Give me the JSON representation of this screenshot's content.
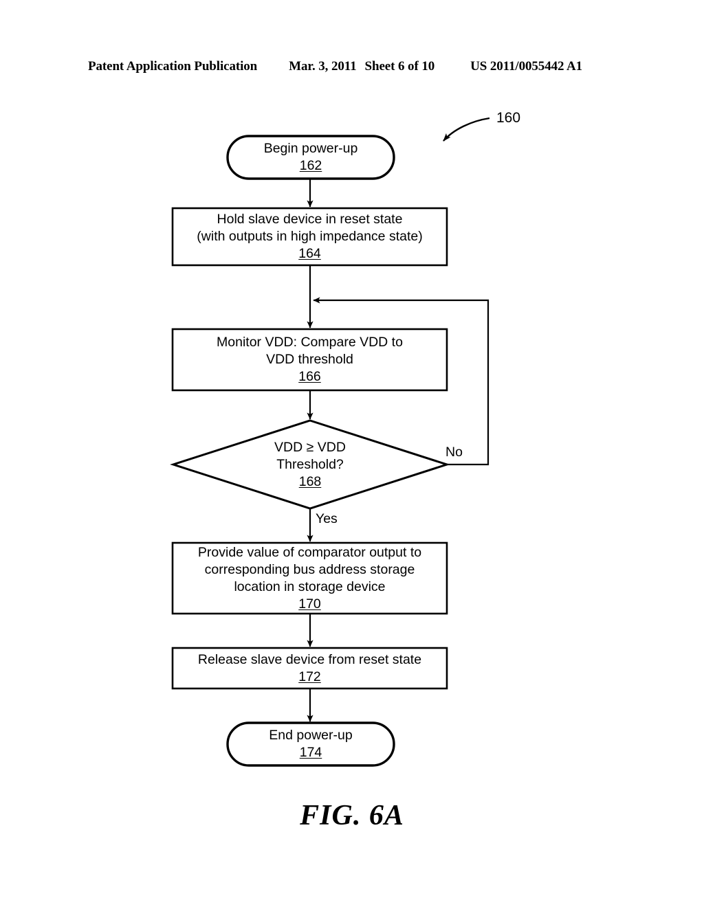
{
  "header": {
    "publication": "Patent Application Publication",
    "date": "Mar. 3, 2011",
    "sheet": "Sheet 6 of 10",
    "patent_number": "US 2011/0055442 A1"
  },
  "figure": {
    "caption": "FIG. 6A",
    "callout_ref": "160"
  },
  "flowchart": {
    "nodes": [
      {
        "id": "begin",
        "shape": "stadium",
        "lines": [
          "Begin power-up"
        ],
        "ref": "162"
      },
      {
        "id": "hold-reset",
        "shape": "rect",
        "lines": [
          "Hold slave device in reset state",
          "(with outputs in high impedance state)"
        ],
        "ref": "164"
      },
      {
        "id": "monitor-vdd",
        "shape": "rect",
        "lines": [
          "Monitor VDD: Compare VDD to",
          "VDD threshold"
        ],
        "ref": "166"
      },
      {
        "id": "vdd-decision",
        "shape": "diamond",
        "lines": [
          "VDD  ≥ VDD",
          "Threshold?"
        ],
        "ref": "168"
      },
      {
        "id": "provide-value",
        "shape": "rect",
        "lines": [
          "Provide value of comparator output to",
          "corresponding bus address storage",
          "location in storage device"
        ],
        "ref": "170"
      },
      {
        "id": "release-reset",
        "shape": "rect",
        "lines": [
          "Release slave device from reset state"
        ],
        "ref": "172"
      },
      {
        "id": "end",
        "shape": "stadium",
        "lines": [
          "End power-up"
        ],
        "ref": "174"
      }
    ],
    "edge_labels": {
      "no": "No",
      "yes": "Yes"
    }
  },
  "colors": {
    "ink": "#000000",
    "paper": "#ffffff"
  }
}
